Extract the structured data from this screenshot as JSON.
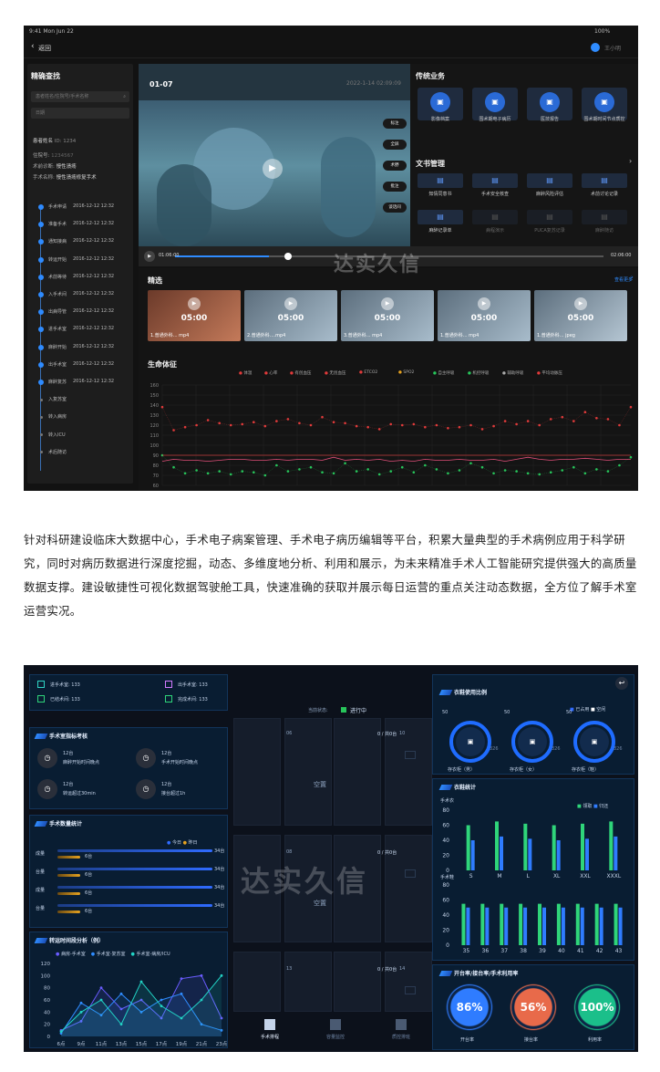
{
  "shot1": {
    "status": {
      "time": "9:41  Mon Jun 22",
      "battery": "100%"
    },
    "back": "返回",
    "user": "王小明",
    "search": {
      "title": "精确查找",
      "placeholder1": "患者姓名/住院号/手术名称",
      "placeholder2": "日期"
    },
    "patient": {
      "name": "患者姓名",
      "id_label": "ID: 1234",
      "ward_label": "住院号:",
      "ward": "1234567",
      "diag_label": "术前诊断:",
      "diag": "慢性溃疡",
      "op_label": "手术名称:",
      "op": "慢性溃疡修复手术"
    },
    "timeline": [
      {
        "label": "手术申请",
        "time": "2016-12-12  12:32",
        "done": true
      },
      {
        "label": "准备手术",
        "time": "2016-12-12  12:32",
        "done": true
      },
      {
        "label": "通知接病",
        "time": "2016-12-12  12:32",
        "done": true
      },
      {
        "label": "转运开始",
        "time": "2016-12-12  12:32",
        "done": true
      },
      {
        "label": "术前等待",
        "time": "2016-12-12  12:32",
        "done": true
      },
      {
        "label": "入手术间",
        "time": "2016-12-12  12:32",
        "done": true
      },
      {
        "label": "出病导管",
        "time": "2016-12-12  12:32",
        "done": true
      },
      {
        "label": "进手术室",
        "time": "2016-12-12  12:32",
        "done": true
      },
      {
        "label": "麻醉开始",
        "time": "2016-12-12  12:32",
        "done": true
      },
      {
        "label": "出手术室",
        "time": "2016-12-12  12:32",
        "done": true
      },
      {
        "label": "麻醉复苏",
        "time": "2016-12-12  12:32",
        "done": true
      },
      {
        "label": "入复苏室",
        "time": "",
        "done": false
      },
      {
        "label": "转入病房",
        "time": "",
        "done": false
      },
      {
        "label": "转入ICU",
        "time": "",
        "done": false
      },
      {
        "label": "术后随访",
        "time": "",
        "done": false
      }
    ],
    "video": {
      "room": "01-07",
      "date": "2022-1-14  02:09:09",
      "buttons": [
        "标注",
        "全屏",
        "术野",
        "批注",
        "谈话间"
      ],
      "current": "01:06:00",
      "total": "02:06:00",
      "progress": 0.22
    },
    "services": {
      "title": "传统业务",
      "items": [
        {
          "label": "影像档案",
          "icon": "image-icon"
        },
        {
          "label": "围术期电子病历",
          "icon": "record-icon"
        },
        {
          "label": "医技报告",
          "icon": "report-icon"
        },
        {
          "label": "围术期时间节点质控",
          "icon": "clock-icon"
        }
      ]
    },
    "docs": {
      "title": "文书管理",
      "items": [
        {
          "label": "知情同意书",
          "dim": false
        },
        {
          "label": "手术安全核查",
          "dim": false
        },
        {
          "label": "麻醉风险评估",
          "dim": false
        },
        {
          "label": "术前讨论记录",
          "dim": false
        },
        {
          "label": "麻醉记录单",
          "dim": false
        },
        {
          "label": "病程演示",
          "dim": true
        },
        {
          "label": "PUCA复苏记录",
          "dim": true
        },
        {
          "label": "麻醉随访",
          "dim": true
        }
      ]
    },
    "featured": {
      "title": "精选",
      "more": "查看更多",
      "items": [
        {
          "duration": "05:00",
          "name": "1.普通外科... mp4"
        },
        {
          "duration": "05:00",
          "name": "2.普通外科....mp4"
        },
        {
          "duration": "05:00",
          "name": "3.普通外科... mp4"
        },
        {
          "duration": "05:00",
          "name": "1.普通外科... mp4"
        },
        {
          "duration": "05:00",
          "name": "1.普通外科... jpeg"
        }
      ]
    },
    "vitals": {
      "title": "生命体征",
      "legend": [
        {
          "name": "体温",
          "color": "#e03a3a"
        },
        {
          "name": "心率",
          "color": "#e03a3a"
        },
        {
          "name": "有创血压",
          "color": "#e03a3a"
        },
        {
          "name": "无创血压",
          "color": "#e03a3a"
        },
        {
          "name": "ETCO2",
          "color": "#e03a3a"
        },
        {
          "name": "SPO2",
          "color": "#e6a21f"
        },
        {
          "name": "自主呼吸",
          "color": "#27c45a"
        },
        {
          "name": "机控呼吸",
          "color": "#27c45a"
        },
        {
          "name": "辅助呼吸",
          "color": "#aaaaaa"
        },
        {
          "name": "平均动脉压",
          "color": "#e03a3a"
        }
      ]
    }
  },
  "chart_data": [
    {
      "type": "scatter",
      "title": "生命体征",
      "ylim": [
        60,
        160
      ],
      "yticks": [
        160,
        150,
        140,
        130,
        120,
        110,
        100,
        90,
        80,
        70,
        60
      ],
      "series": [
        {
          "name": "心率",
          "color": "#e03a3a",
          "values": [
            138,
            115,
            118,
            120,
            125,
            122,
            120,
            121,
            123,
            119,
            124,
            126,
            122,
            120,
            128,
            123,
            122,
            119,
            118,
            116,
            121,
            120,
            121,
            118,
            120,
            117,
            118,
            120,
            116,
            119,
            124,
            121,
            124,
            120,
            126,
            128,
            124,
            133,
            127,
            126,
            120,
            138
          ]
        },
        {
          "name": "自主呼吸",
          "color": "#27c45a",
          "values": [
            90,
            78,
            72,
            75,
            72,
            74,
            71,
            74,
            73,
            70,
            80,
            74,
            76,
            78,
            73,
            72,
            82,
            74,
            76,
            71,
            74,
            78,
            73,
            80,
            76,
            72,
            75,
            82,
            78,
            72,
            75,
            74,
            72,
            71,
            73,
            75,
            78,
            72,
            76,
            74,
            80,
            88
          ]
        },
        {
          "name": "有创血压",
          "color": "#e03a3a",
          "values": [
            84,
            86,
            85,
            85,
            84,
            85,
            86,
            86,
            85,
            85,
            86,
            85,
            86,
            86,
            85,
            88,
            85,
            86,
            85,
            86,
            84,
            85,
            84,
            86,
            85,
            85,
            86,
            85,
            85,
            86,
            84,
            86,
            88,
            86,
            85,
            86,
            86,
            87,
            86,
            85,
            86,
            86
          ]
        },
        {
          "name": "平均动脉压",
          "color": "#e03a3a",
          "values": [
            90,
            90,
            90,
            90,
            90,
            90,
            90,
            90,
            90,
            90,
            90,
            90,
            90,
            90,
            90,
            90,
            90,
            90,
            90,
            90,
            90,
            90,
            90,
            90,
            90,
            90,
            90,
            90,
            90,
            90,
            90,
            90,
            90,
            90,
            90,
            90,
            90,
            90,
            90,
            90,
            90,
            90
          ]
        }
      ]
    },
    {
      "type": "bar",
      "title": "手术数量统计",
      "categories": [
        "成量",
        "台量",
        "成量",
        "台量"
      ],
      "series": [
        {
          "name": "今日",
          "color": "#2f6bff",
          "values": [
            34,
            34,
            34,
            34
          ]
        },
        {
          "name": "昨日",
          "color": "#e6a21f",
          "values": [
            6,
            6,
            6,
            6
          ]
        }
      ],
      "unit": "台"
    },
    {
      "type": "line",
      "title": "转运时间段分析（例）",
      "categories": [
        "6点",
        "9点",
        "11点",
        "13点",
        "15点",
        "17点",
        "19点",
        "21点",
        "23点"
      ],
      "ylim": [
        0,
        120
      ],
      "yticks": [
        120,
        100,
        80,
        60,
        40,
        20,
        0
      ],
      "series": [
        {
          "name": "病房-手术室",
          "color": "#6a5cff",
          "values": [
            10,
            25,
            80,
            45,
            60,
            30,
            95,
            100,
            30
          ]
        },
        {
          "name": "手术室-复苏室",
          "color": "#2f8cff",
          "values": [
            5,
            55,
            35,
            70,
            40,
            60,
            70,
            20,
            10
          ]
        },
        {
          "name": "手术室-病房/ICU",
          "color": "#22d3c5",
          "values": [
            8,
            40,
            60,
            20,
            90,
            50,
            30,
            60,
            100
          ]
        }
      ]
    },
    {
      "type": "bar",
      "title": "衣鞋统计",
      "subtitle": "手术衣",
      "categories": [
        "S",
        "M",
        "L",
        "XL",
        "XXL",
        "XXXL"
      ],
      "ylim": [
        0,
        80
      ],
      "yticks": [
        80,
        60,
        40,
        20,
        0
      ],
      "series": [
        {
          "name": "领取",
          "color": "#2fd57a",
          "values": [
            60,
            65,
            62,
            60,
            62,
            65
          ]
        },
        {
          "name": "归还",
          "color": "#2f7cff",
          "values": [
            40,
            45,
            42,
            40,
            42,
            45
          ]
        }
      ]
    },
    {
      "type": "bar",
      "subtitle": "手术鞋",
      "categories": [
        "35",
        "36",
        "37",
        "38",
        "39",
        "40",
        "41",
        "42",
        "43"
      ],
      "ylim": [
        0,
        80
      ],
      "yticks": [
        80,
        60,
        40,
        20,
        0
      ],
      "series": [
        {
          "name": "领取",
          "color": "#2fd57a",
          "values": [
            55,
            55,
            55,
            55,
            55,
            55,
            55,
            55,
            55
          ]
        },
        {
          "name": "归还",
          "color": "#2f7cff",
          "values": [
            50,
            50,
            50,
            50,
            50,
            50,
            50,
            50,
            50
          ]
        }
      ]
    }
  ],
  "paragraph": "针对科研建设临床大数据中心，手术电子病案管理、手术电子病历编辑等平台，积累大量典型的手术病例应用于科学研究，同时对病历数据进行深度挖掘，动态、多维度地分析、利用和展示，为未来精准手术人工智能研究提供强大的高质量数据支撑。建设敏捷性可视化数据驾驶舱工具，快速准确的获取并展示每日运营的重点关注动态数据，全方位了解手术室运营实况。",
  "watermark": "达实久信",
  "shot2": {
    "top_stats": [
      {
        "label": "进手术室: 133"
      },
      {
        "label": "出手术室: 133"
      },
      {
        "label": "已结术间: 133"
      },
      {
        "label": "完成术间: 133"
      }
    ],
    "status_label": "当前状态:",
    "status_value": "进行中",
    "kpi": {
      "title": "手术室指标考核",
      "items": [
        {
          "value": "12台",
          "label": "麻醉开始时间晚点"
        },
        {
          "value": "12台",
          "label": "手术开始时间晚点"
        },
        {
          "value": "12台",
          "label": "转运超过30min"
        },
        {
          "value": "12台",
          "label": "接台超过1h"
        }
      ]
    },
    "counts": {
      "title": "手术数量统计",
      "legend_today": "今日",
      "legend_yest": "昨日",
      "rows": [
        {
          "cat": "成量",
          "yest": "6台",
          "today": "34台"
        },
        {
          "cat": "台量",
          "yest": "6台",
          "today": "34台"
        },
        {
          "cat": "成量",
          "yest": "6台",
          "today": "34台"
        },
        {
          "cat": "台量",
          "yest": "6台",
          "today": "34台"
        }
      ]
    },
    "transport": {
      "title": "转运时间段分析（例）",
      "legend": [
        "病房-手术室",
        "手术室-复苏室",
        "手术室-病房/ICU"
      ]
    },
    "rooms": [
      {
        "id": "06",
        "value": "0 / 共0台",
        "status": "空置"
      },
      {
        "id": "08",
        "value": "0 / 共0台",
        "status": "空置"
      },
      {
        "id": "13",
        "value": "0 / 共0台",
        "status": ""
      }
    ],
    "room_short": [
      "10",
      "14"
    ],
    "cloth_usage": {
      "title": "衣鞋使用比例",
      "legend": [
        "已占用",
        "空闲"
      ],
      "items": [
        {
          "label": "存衣柜（男）",
          "a": "50",
          "b": "326"
        },
        {
          "label": "存衣柜（女）",
          "a": "50",
          "b": "326"
        },
        {
          "label": "存衣柜（鞋）",
          "a": "50",
          "b": "326"
        }
      ]
    },
    "cloth_stats": {
      "title": "衣鞋统计",
      "legend": [
        "领取",
        "归还"
      ],
      "sub1": "手术衣",
      "sub2": "手术鞋"
    },
    "rates": {
      "title": "开台率/接台率/手术利用率",
      "items": [
        {
          "value": "86%",
          "label": "开台率",
          "color": "#2f7cff"
        },
        {
          "value": "56%",
          "label": "接台率",
          "color": "#e86a4a"
        },
        {
          "value": "100%",
          "label": "利用率",
          "color": "#1bbf8a"
        }
      ]
    },
    "nav": [
      {
        "label": "手术排程",
        "active": true
      },
      {
        "label": "容量监控",
        "active": false
      },
      {
        "label": "质控排班",
        "active": false
      }
    ]
  }
}
